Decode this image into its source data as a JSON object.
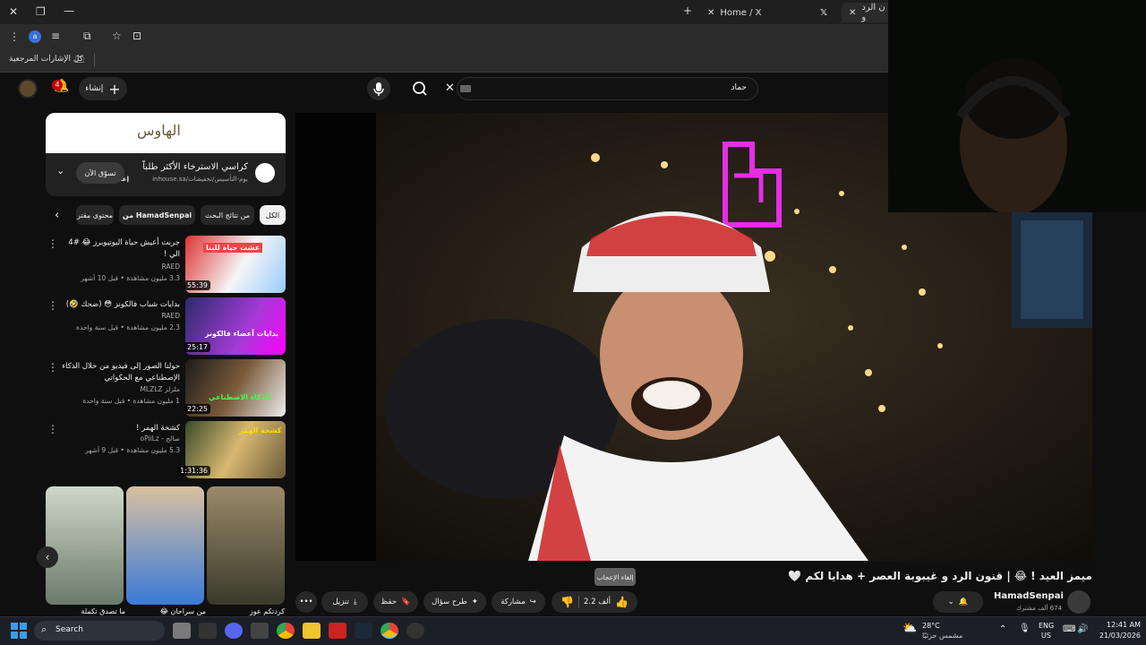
{
  "browser": {
    "tabs": [
      {
        "label": "Home / X",
        "close": "✕"
      },
      {
        "label": "ن الرد و",
        "close": "✕"
      }
    ],
    "new_tab": "+",
    "profile_letter": "a",
    "bookmarks_label": "كل الإشارات المرجعية"
  },
  "youtube": {
    "search_value": "حماد",
    "notif_count": "4",
    "create_label": "إنشاء",
    "ad": {
      "brand": "الهاوس",
      "title": "كراسي الاسترخاء الأكثر طلباً",
      "sponsored": "إعلان",
      "url": "inhouse.sa/بوم-التأسيس/تخفيضات",
      "cta": "تسوّق الآن"
    },
    "chips": [
      "الكل",
      "من نتائج البحث",
      "من HamadSenpai",
      "محتوى مقتر"
    ],
    "recommendations": [
      {
        "title": "جربت أعيش حياة اليوتيوبرز 😂 #4 الي !",
        "channel": "RAED",
        "views": "3.3 مليون مشاهدة",
        "age": "قبل 10 أشهر",
        "duration": "55:39",
        "thumb_text": "عشت حياة للبنا"
      },
      {
        "title": "بدايات شباب فالكونز 😳 (ضحك 🤣)",
        "channel": "RAED",
        "views": "2.3 مليون مشاهدة",
        "age": "قبل سنة واحدة",
        "duration": "25:17",
        "thumb_text": "بدايات أعضاء فالكونز"
      },
      {
        "title": "حولنا الصور إلى فيديو من خلال الذكاء الإصطناعي مع الحكواتي",
        "channel": "ملزلز MLZLZ",
        "views": "1 مليون مشاهدة",
        "age": "قبل سنة واحدة",
        "duration": "22:25",
        "thumb_text": "الذكاء الاصطناعي"
      },
      {
        "title": "كشخة الهمر !",
        "channel": "صالح - oPiiLz",
        "views": "5.3 مليون مشاهدة",
        "age": "قبل 9 أشهر",
        "duration": "1:31:36",
        "thumb_text": "كشخة الهمر"
      }
    ],
    "shorts_captions": [
      "ما تصدق تكملة",
      "من سراحان 😂",
      "كردتكم عوز"
    ],
    "video": {
      "title": "ميمز العيد ! 😂 | قنون الرد و غيبوبة العصر + هدايا لكم 🤍",
      "channel": "HamadSenpai",
      "subscribers": "674 ألف مشترك",
      "likes": "2.2 ألف",
      "tooltip": "إلغاء الإعجاب",
      "share": "مشاركة",
      "ask": "طرح سؤال",
      "save": "حفظ",
      "download": "تنزيل",
      "more": "•••"
    }
  },
  "taskbar": {
    "search": "Search",
    "weather_temp": "28°C",
    "weather_desc": "مشمس جزئيًا",
    "lang": "ENG",
    "region": "US",
    "time": "12:41 AM",
    "date": "21/03/2026"
  },
  "colors": {
    "accent_red": "#cc0000",
    "bg": "#0f0f0f",
    "pill": "#272727",
    "neon": "#e62ee6"
  }
}
